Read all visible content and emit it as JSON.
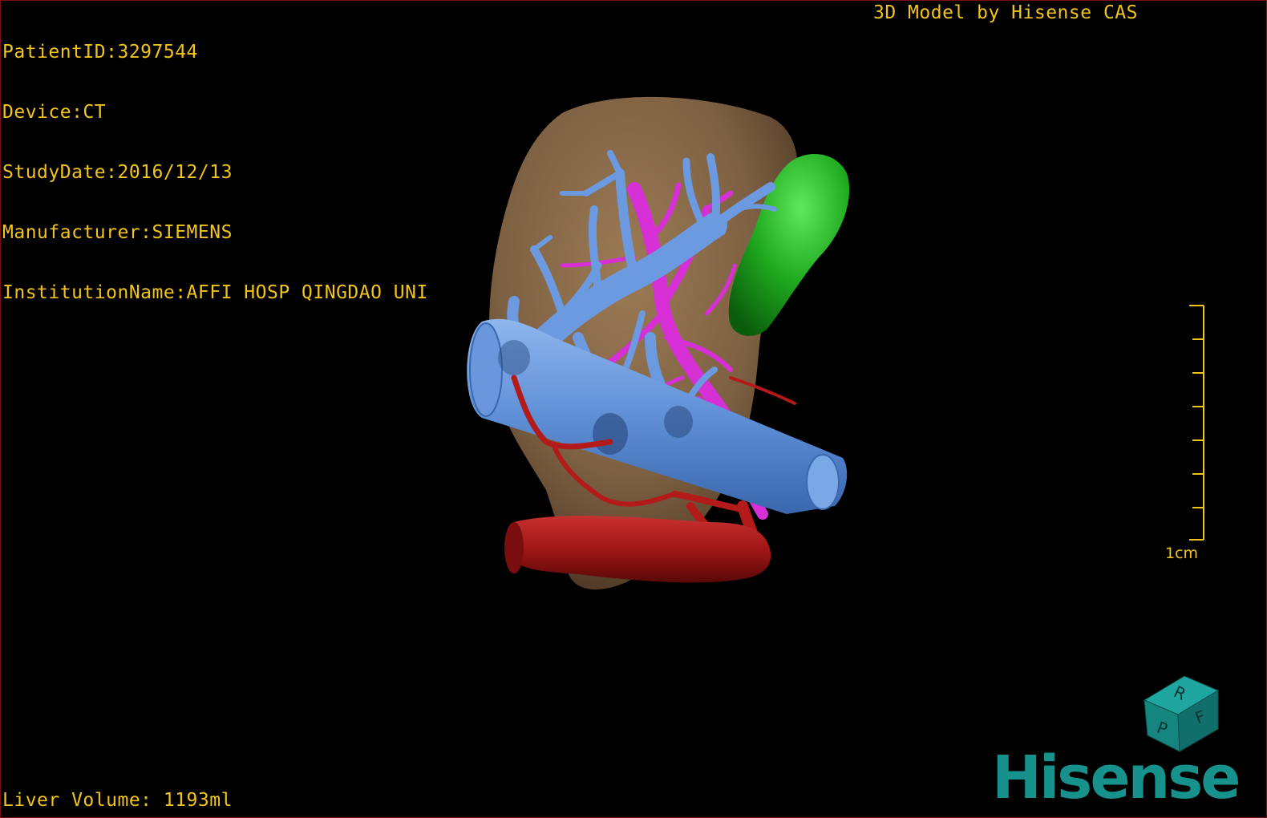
{
  "overlay": {
    "patient_id": "PatientID:3297544",
    "device": "Device:CT",
    "study_date": "StudyDate:2016/12/13",
    "manufacturer": "Manufacturer:SIEMENS",
    "institution": "InstitutionName:AFFI HOSP QINGDAO UNI",
    "credit": "3D Model by Hisense CAS",
    "liver_volume": "Liver Volume: 1193ml"
  },
  "scale_bar": {
    "label": "1cm"
  },
  "orientation_cube": {
    "face_top": "R",
    "face_front_a": "F",
    "face_front_b": "P"
  },
  "brand": {
    "logo_text": "Hisense"
  },
  "colors": {
    "overlay_text": "#f2c41a",
    "liver": "#8a6a4a",
    "portal_vein": "#5f8fd6",
    "hepatic_vein": "#d62fd6",
    "artery": "#b31a1a",
    "gallbladder": "#1faa1f",
    "logo": "#17918c"
  }
}
